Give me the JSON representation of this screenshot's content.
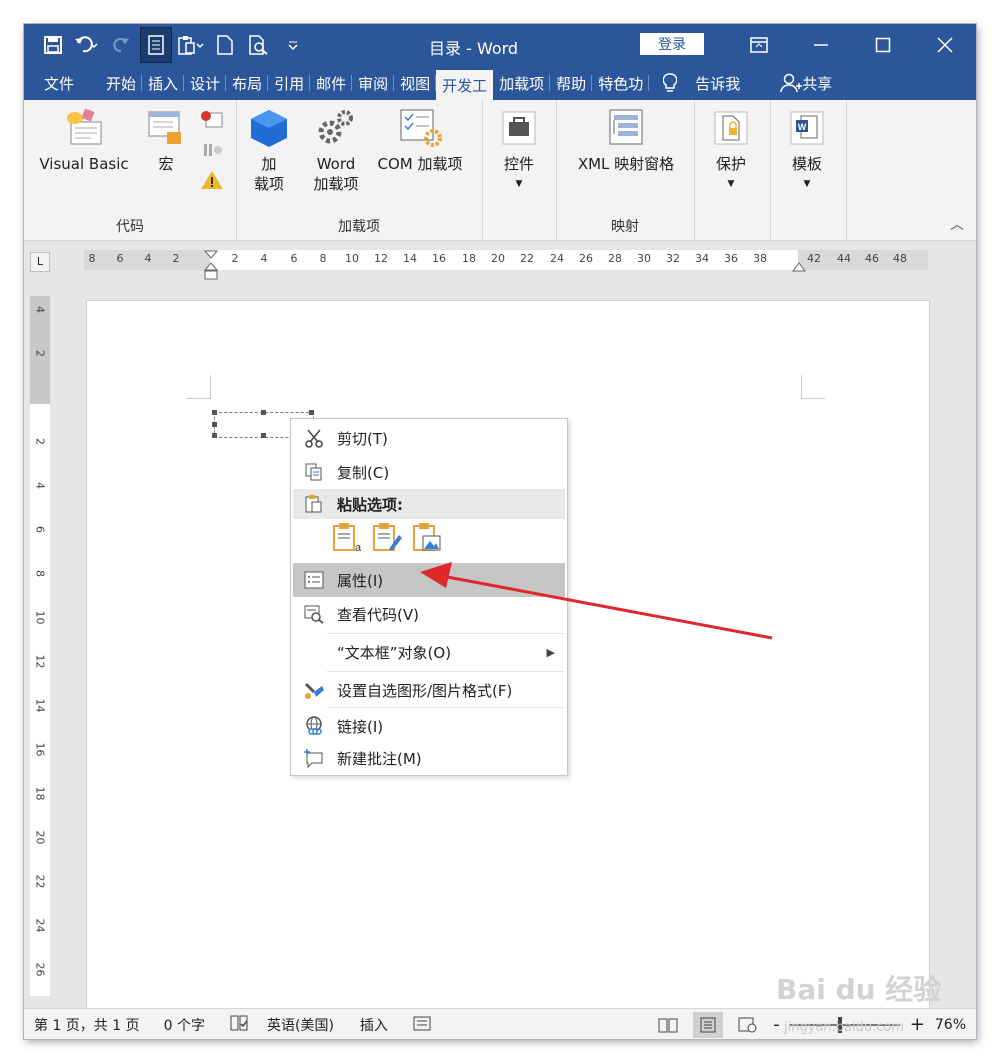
{
  "window": {
    "title": "目录 - Word",
    "login_label": "登录",
    "controls": [
      "ribbon-display-icon",
      "minimize-icon",
      "maximize-icon",
      "close-icon"
    ]
  },
  "qat": {
    "items": [
      "save-icon",
      "undo-icon",
      "redo-icon",
      "design-mode-icon",
      "paste-dropdown-icon",
      "new-document-icon",
      "print-preview-icon",
      "customize-qat-icon"
    ]
  },
  "tabs": [
    {
      "label": "文件"
    },
    {
      "label": "开始"
    },
    {
      "label": "插入"
    },
    {
      "label": "设计"
    },
    {
      "label": "布局"
    },
    {
      "label": "引用"
    },
    {
      "label": "邮件"
    },
    {
      "label": "审阅"
    },
    {
      "label": "视图"
    },
    {
      "label": "开发工"
    },
    {
      "label": "加载项"
    },
    {
      "label": "帮助"
    },
    {
      "label": "特色功"
    }
  ],
  "tellme": {
    "label": "告诉我"
  },
  "share": {
    "label": "共享"
  },
  "ribbon": {
    "code_group": {
      "label": "代码",
      "visual_basic": "Visual Basic",
      "macro": "宏"
    },
    "addins_group": {
      "label": "加载项",
      "addins_line1": "加",
      "addins_line2": "载项",
      "word_addins_line1": "Word",
      "word_addins_line2": "加载项",
      "com_addins": "COM 加载项"
    },
    "controls_group": {
      "label": "控件"
    },
    "mapping_group": {
      "label": "映射",
      "xml_pane": "XML 映射窗格"
    },
    "protect_group": {
      "label": "保护"
    },
    "templates_group": {
      "label": "模板"
    }
  },
  "ruler": {
    "h_ticks": [
      "8",
      "6",
      "4",
      "2",
      "2",
      "4",
      "6",
      "8",
      "10",
      "12",
      "14",
      "16",
      "18",
      "20",
      "22",
      "24",
      "26",
      "28",
      "30",
      "32",
      "34",
      "36",
      "38",
      "42",
      "44",
      "46",
      "48"
    ],
    "v_ticks": [
      "4",
      "2",
      "2",
      "4",
      "6",
      "8",
      "10",
      "12",
      "14",
      "16",
      "18",
      "20",
      "22",
      "24",
      "26"
    ]
  },
  "context_menu": {
    "items": [
      {
        "label": "剪切(T)",
        "icon": "scissors-icon"
      },
      {
        "label": "复制(C)",
        "icon": "copy-icon"
      },
      {
        "label": "粘贴选项:",
        "icon": "paste-icon"
      },
      {
        "label": "属性(I)",
        "icon": "properties-icon"
      },
      {
        "label": "查看代码(V)",
        "icon": "view-code-icon"
      },
      {
        "label": "“文本框”对象(O)",
        "icon": ""
      },
      {
        "label": "设置自选图形/图片格式(F)",
        "icon": "format-shape-icon"
      },
      {
        "label": "链接(I)",
        "icon": "link-icon"
      },
      {
        "label": "新建批注(M)",
        "icon": "comment-icon"
      }
    ],
    "paste_options": [
      "keep-source-formatting-icon",
      "merge-formatting-icon",
      "picture-paste-icon"
    ],
    "highlighted": "属性(I)"
  },
  "status": {
    "page": "第 1 页，共 1 页",
    "words": "0 个字",
    "language": "英语(美国)",
    "mode": "插入",
    "zoom": "76%",
    "zoom_minus": "-",
    "zoom_plus": "+"
  },
  "watermark": {
    "text": "Bai du 经验",
    "url": "jingyan.baidu.com"
  },
  "colors": {
    "accent": "#2b579a",
    "arrow": "#e0272b",
    "highlight": "#c6c6c6"
  }
}
